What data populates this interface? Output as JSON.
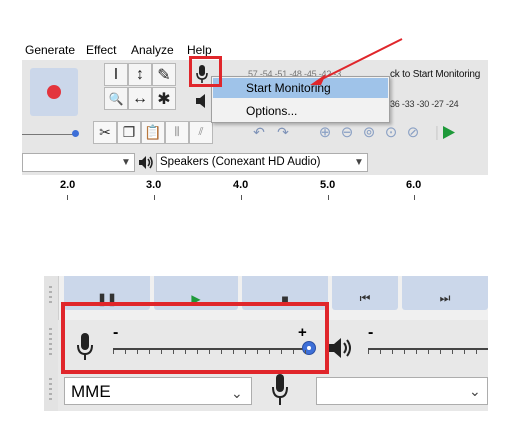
{
  "menubar": {
    "items": [
      "Generate",
      "Effect",
      "Analyze",
      "Help"
    ]
  },
  "tools": {
    "select_symbol": "I",
    "envelope_symbol": "↕",
    "draw_symbol": "✎",
    "zoom_symbol": "🔍",
    "timeshift_symbol": "↔",
    "multi_symbol": "✱"
  },
  "meter": {
    "rec_scale": "57 -54 -51 -48 -45 -42 -3",
    "click_hint": "ck to Start Monitoring",
    "play_scale": "36 -33 -30 -27 -24"
  },
  "monitor_menu": {
    "start_label": "Start Monitoring",
    "options_label": "Options..."
  },
  "output_device": {
    "name": "Speakers (Conexant HD Audio)"
  },
  "ruler": {
    "labels": [
      "2.0",
      "3.0",
      "4.0",
      "5.0",
      "6.0"
    ]
  },
  "bottom": {
    "minus_label": "-",
    "plus_label": "+",
    "minus_label_2": "-",
    "host_value": "MME",
    "slider_level": 1.0
  },
  "colors": {
    "highlight": "#e0262b",
    "record": "#e3343d",
    "slider_thumb": "#3d6fd8",
    "menu_selection": "#9fc3e9"
  }
}
